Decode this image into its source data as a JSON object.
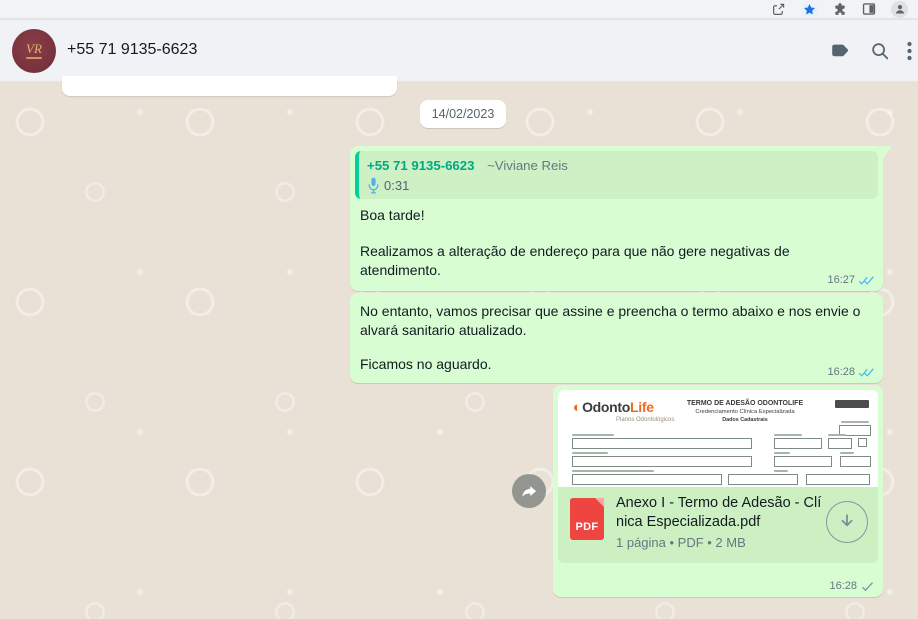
{
  "browser": {
    "toolbar_icons": [
      "share-icon",
      "bookmark-star-icon",
      "extensions-icon",
      "side-panel-icon",
      "profile-icon"
    ]
  },
  "header": {
    "title": "+55 71 9135-6623",
    "avatar_monogram": "VR",
    "icons": [
      "label-icon",
      "search-icon",
      "menu-icon"
    ]
  },
  "chat": {
    "date_divider": "14/02/2023",
    "messages": [
      {
        "type": "text",
        "direction": "outgoing",
        "quote": {
          "sender_number": "+55 71 9135-6623",
          "sender_name": "~Viviane Reis",
          "voice_duration": "0:31"
        },
        "paragraphs": [
          "Boa tarde!",
          "Realizamos a alteração de endereço para que não gere negativas de atendimento."
        ],
        "time": "16:27",
        "status": "read"
      },
      {
        "type": "text",
        "direction": "outgoing",
        "paragraphs": [
          "No entanto, vamos precisar que assine e preencha o termo abaixo e nos envie o alvará sanitario atualizado.",
          "Ficamos no aguardo."
        ],
        "time": "16:28",
        "status": "read"
      },
      {
        "type": "document",
        "direction": "outgoing",
        "file": {
          "name": "Anexo I - Termo de Adesão - Clínica Especializada.pdf",
          "meta": "1 página • PDF • 2 MB",
          "kind": "PDF"
        },
        "preview": {
          "logo_primary": "Odonto",
          "logo_secondary": "Life",
          "logo_mark": "◖",
          "logo_tagline": "Planos Odontológicos",
          "title": "TERMO DE ADESÃO ODONTOLIFE",
          "subtitle": "Credenciamento Clínica Especializada",
          "subtitle2": "Dados Cadastrais"
        },
        "time": "16:28",
        "status": "sent"
      }
    ]
  },
  "colors": {
    "accent_teal": "#00a884",
    "quote_border": "#06cf9c",
    "bubble_out": "#d9fdd3",
    "tick_read": "#53bdeb",
    "tick_sent": "#8696a0",
    "pdf_red": "#ee4540",
    "avatar_maroon": "#6e2e38",
    "logo_orange": "#f26a21",
    "chat_bg": "#e9e1d6"
  }
}
